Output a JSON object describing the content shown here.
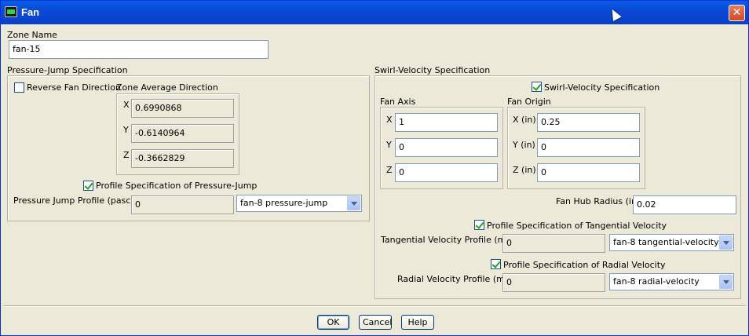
{
  "window": {
    "title": "Fan",
    "close_symbol": "✕"
  },
  "zone_name": {
    "label": "Zone Name",
    "value": "fan-15"
  },
  "pressure_jump": {
    "group_label": "Pressure-Jump Specification",
    "reverse_label": "Reverse Fan Direction",
    "reverse_checked": false,
    "zone_avg_label": "Zone Average Direction",
    "x_label": "X",
    "x_value": "0.6990868",
    "y_label": "Y",
    "y_value": "-0.6140964",
    "z_label": "Z",
    "z_value": "-0.3662829",
    "profile_spec_label": "Profile Specification of Pressure-Jump",
    "profile_spec_checked": true,
    "profile_label": "Pressure Jump Profile (pascal)",
    "profile_value": "0",
    "profile_select": "fan-8 pressure-jump"
  },
  "swirl": {
    "group_label": "Swirl-Velocity Specification",
    "swirl_check_label": "Swirl-Velocity Specification",
    "swirl_checked": true,
    "fan_axis": {
      "label": "Fan Axis",
      "x_label": "X",
      "x_value": "1",
      "y_label": "Y",
      "y_value": "0",
      "z_label": "Z",
      "z_value": "0"
    },
    "fan_origin": {
      "label": "Fan Origin",
      "x_label": "X (in)",
      "x_value": "0.25",
      "y_label": "Y (in)",
      "y_value": "0",
      "z_label": "Z (in)",
      "z_value": "0"
    },
    "hub_radius_label": "Fan Hub Radius (in)",
    "hub_radius_value": "0.02",
    "tangential_spec_label": "Profile Specification of Tangential Velocity",
    "tangential_checked": true,
    "tangential_label": "Tangential Velocity Profile (m/s)",
    "tangential_value": "0",
    "tangential_select": "fan-8 tangential-velocity",
    "radial_spec_label": "Profile Specification of Radial Velocity",
    "radial_checked": true,
    "radial_label": "Radial Velocity Profile (m/s)",
    "radial_value": "0",
    "radial_select": "fan-8 radial-velocity"
  },
  "buttons": {
    "ok": "OK",
    "cancel": "Cancel",
    "help": "Help"
  }
}
